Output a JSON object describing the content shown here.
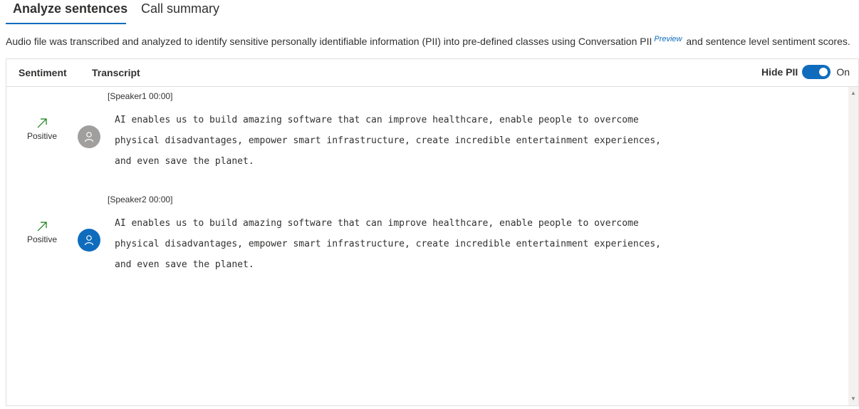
{
  "tabs": {
    "analyze_label": "Analyze sentences",
    "summary_label": "Call summary"
  },
  "description": {
    "text_before": "Audio file was transcribed and analyzed to identify sensitive personally identifiable information (PII) into pre-defined classes using Conversation PII",
    "preview_badge": "Preview",
    "text_after": "and sentence level sentiment scores."
  },
  "table_header": {
    "sentiment_label": "Sentiment",
    "transcript_label": "Transcript",
    "hide_pii_label": "Hide PII",
    "hide_pii_state": "On"
  },
  "colors": {
    "accent": "#0f6cbd",
    "positive_arrow": "#107c10",
    "avatar_gray": "#a19f9d"
  },
  "entries": [
    {
      "speaker": "[Speaker1 00:00]",
      "sentiment": "Positive",
      "sentiment_icon": "arrow-up-right-icon",
      "avatar_icon": "person-icon",
      "lines": [
        "AI enables us to build amazing software that can improve healthcare, enable people to overcome",
        "physical disadvantages, empower smart infrastructure, create incredible entertainment experiences,",
        "and even save the planet."
      ]
    },
    {
      "speaker": "[Speaker2 00:00]",
      "sentiment": "Positive",
      "sentiment_icon": "arrow-up-right-icon",
      "avatar_icon": "person-icon",
      "lines": [
        "AI enables us to build amazing software that can improve healthcare, enable people to overcome",
        "physical disadvantages, empower smart infrastructure, create incredible entertainment experiences,",
        "and even save the planet."
      ]
    }
  ]
}
